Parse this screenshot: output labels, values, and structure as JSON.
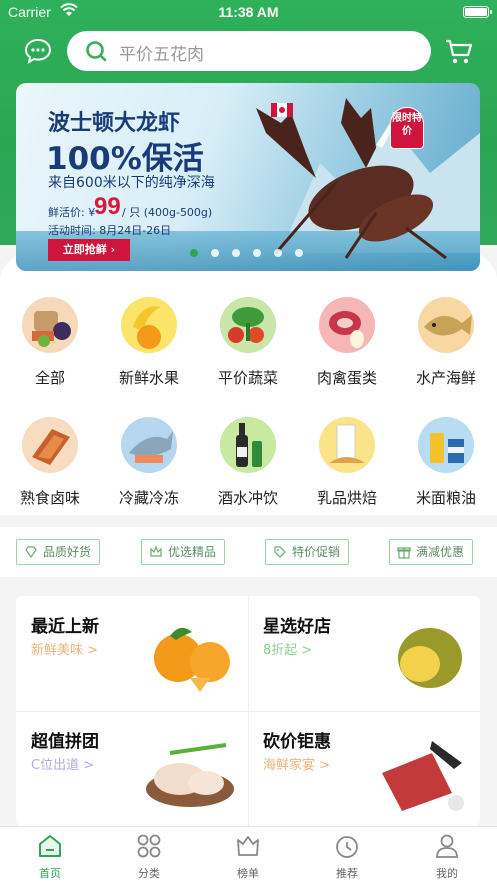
{
  "status_bar": {
    "carrier": "Carrier",
    "time": "11:38 AM"
  },
  "search": {
    "placeholder": "平价五花肉"
  },
  "banner": {
    "title": "波士顿大龙虾",
    "headline": "100%保活",
    "subtitle": "来自600米以下的纯净深海",
    "price_label": "鲜活价: ¥",
    "price": "99",
    "price_unit": "/ 只 (400g-500g)",
    "date": "活动时间: 8月24日-26日",
    "cta": "立即抢鲜 ›",
    "badge": "限时特价",
    "dots": 6,
    "active_dot": 0
  },
  "categories": [
    {
      "label": "全部",
      "icon": "assorted-groceries-icon"
    },
    {
      "label": "新鲜水果",
      "icon": "banana-orange-icon"
    },
    {
      "label": "平价蔬菜",
      "icon": "vegetables-icon"
    },
    {
      "label": "肉禽蛋类",
      "icon": "meat-egg-icon"
    },
    {
      "label": "水产海鲜",
      "icon": "fish-icon"
    },
    {
      "label": "熟食卤味",
      "icon": "cooked-meat-icon"
    },
    {
      "label": "冷藏冷冻",
      "icon": "frozen-fish-icon"
    },
    {
      "label": "酒水冲饮",
      "icon": "wine-bottle-icon"
    },
    {
      "label": "乳品烘焙",
      "icon": "milk-bread-icon"
    },
    {
      "label": "米面粮油",
      "icon": "oil-rice-icon"
    }
  ],
  "tags": [
    {
      "label": "品质好货",
      "icon": "diamond-icon"
    },
    {
      "label": "优选精品",
      "icon": "crown-icon"
    },
    {
      "label": "特价促销",
      "icon": "price-tag-icon"
    },
    {
      "label": "满减优惠",
      "icon": "gift-icon"
    }
  ],
  "blocks": [
    {
      "title": "最近上新",
      "sub": "新鲜美味 >",
      "sub_color": "#f0b27a",
      "icon": "oranges-icon"
    },
    {
      "title": "星选好店",
      "sub": "8折起 >",
      "sub_color": "#8fd18f",
      "icon": "durian-icon"
    },
    {
      "title": "超值拼团",
      "sub": "C位出道 >",
      "sub_color": "#b9a5e6",
      "icon": "chicken-icon"
    },
    {
      "title": "砍价钜惠",
      "sub": "海鲜家宴 >",
      "sub_color": "#f0b27a",
      "icon": "seafood-icon"
    }
  ],
  "tabbar": [
    {
      "label": "首页",
      "icon": "home-icon",
      "active": true
    },
    {
      "label": "分类",
      "icon": "category-grid-icon",
      "active": false
    },
    {
      "label": "榜单",
      "icon": "crown-ranking-icon",
      "active": false
    },
    {
      "label": "推荐",
      "icon": "recommend-icon",
      "active": false
    },
    {
      "label": "我的",
      "icon": "profile-icon",
      "active": false
    }
  ],
  "colors": {
    "brand": "#2fa455",
    "accent": "#d0143b"
  }
}
